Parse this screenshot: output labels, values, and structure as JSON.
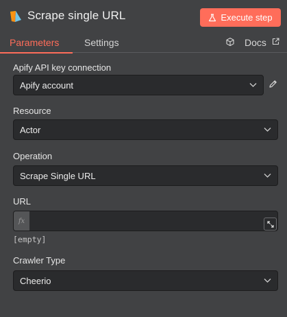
{
  "header": {
    "title": "Scrape single URL",
    "execute_label": "Execute step",
    "logo_icon": "apify-logo-icon",
    "accent_color": "#ff6d5a"
  },
  "tabs": {
    "parameters": "Parameters",
    "settings": "Settings",
    "docs": "Docs",
    "active": "Parameters"
  },
  "fields": {
    "credential": {
      "label": "Apify API key connection",
      "value": "Apify account"
    },
    "resource": {
      "label": "Resource",
      "value": "Actor"
    },
    "operation": {
      "label": "Operation",
      "value": "Scrape Single URL"
    },
    "url": {
      "label": "URL",
      "value": "",
      "expression_prefix": "fx",
      "hint": "[empty]"
    },
    "crawler": {
      "label": "Crawler Type",
      "value": "Cheerio"
    }
  }
}
